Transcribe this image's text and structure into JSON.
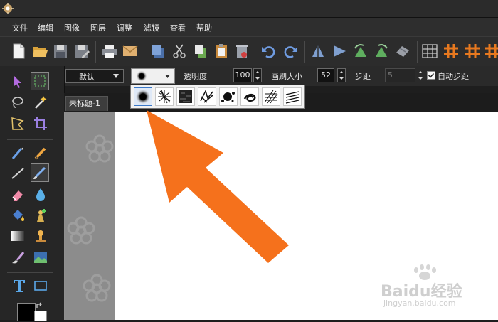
{
  "menu": {
    "items": [
      "文件",
      "编辑",
      "图像",
      "图层",
      "调整",
      "滤镜",
      "查看",
      "帮助"
    ]
  },
  "options": {
    "preset": "默认",
    "opacity_label": "透明度",
    "opacity_value": "100",
    "brush_size_label": "画刷大小",
    "brush_size_value": "52",
    "step_label": "步距",
    "step_value": "5",
    "auto_step_label": "自动步距",
    "auto_step_checked": true
  },
  "document": {
    "tab_title": "未标题-1"
  },
  "brush_popup": {
    "brushes": [
      "soft-round-brush",
      "spray-brush",
      "grunge-brush",
      "scribble-brush",
      "splatter-brush",
      "swirl-brush",
      "crosshatch-brush",
      "lines-brush"
    ],
    "selected_index": 0
  },
  "annotation": {
    "arrow_color": "#f5711c"
  },
  "colors": {
    "foreground": "#000000",
    "background": "#ffffff"
  },
  "watermark": {
    "brand": "Baidu经验",
    "url": "jingyan.baidu.com"
  },
  "icons": {
    "toolbar": [
      "new-file-icon",
      "open-folder-icon",
      "save-icon",
      "save-as-icon",
      "print-icon",
      "mail-icon",
      "copy-layer-icon",
      "cut-icon",
      "copy-icon",
      "paste-icon",
      "clear-icon",
      "undo-icon",
      "redo-icon",
      "flip-vertical-icon",
      "flip-horizontal-icon",
      "rotate-left-icon",
      "rotate-right-icon",
      "rotate-icon",
      "grid-icon",
      "hash-icon",
      "hash-icon-2",
      "hash-icon-3"
    ]
  }
}
